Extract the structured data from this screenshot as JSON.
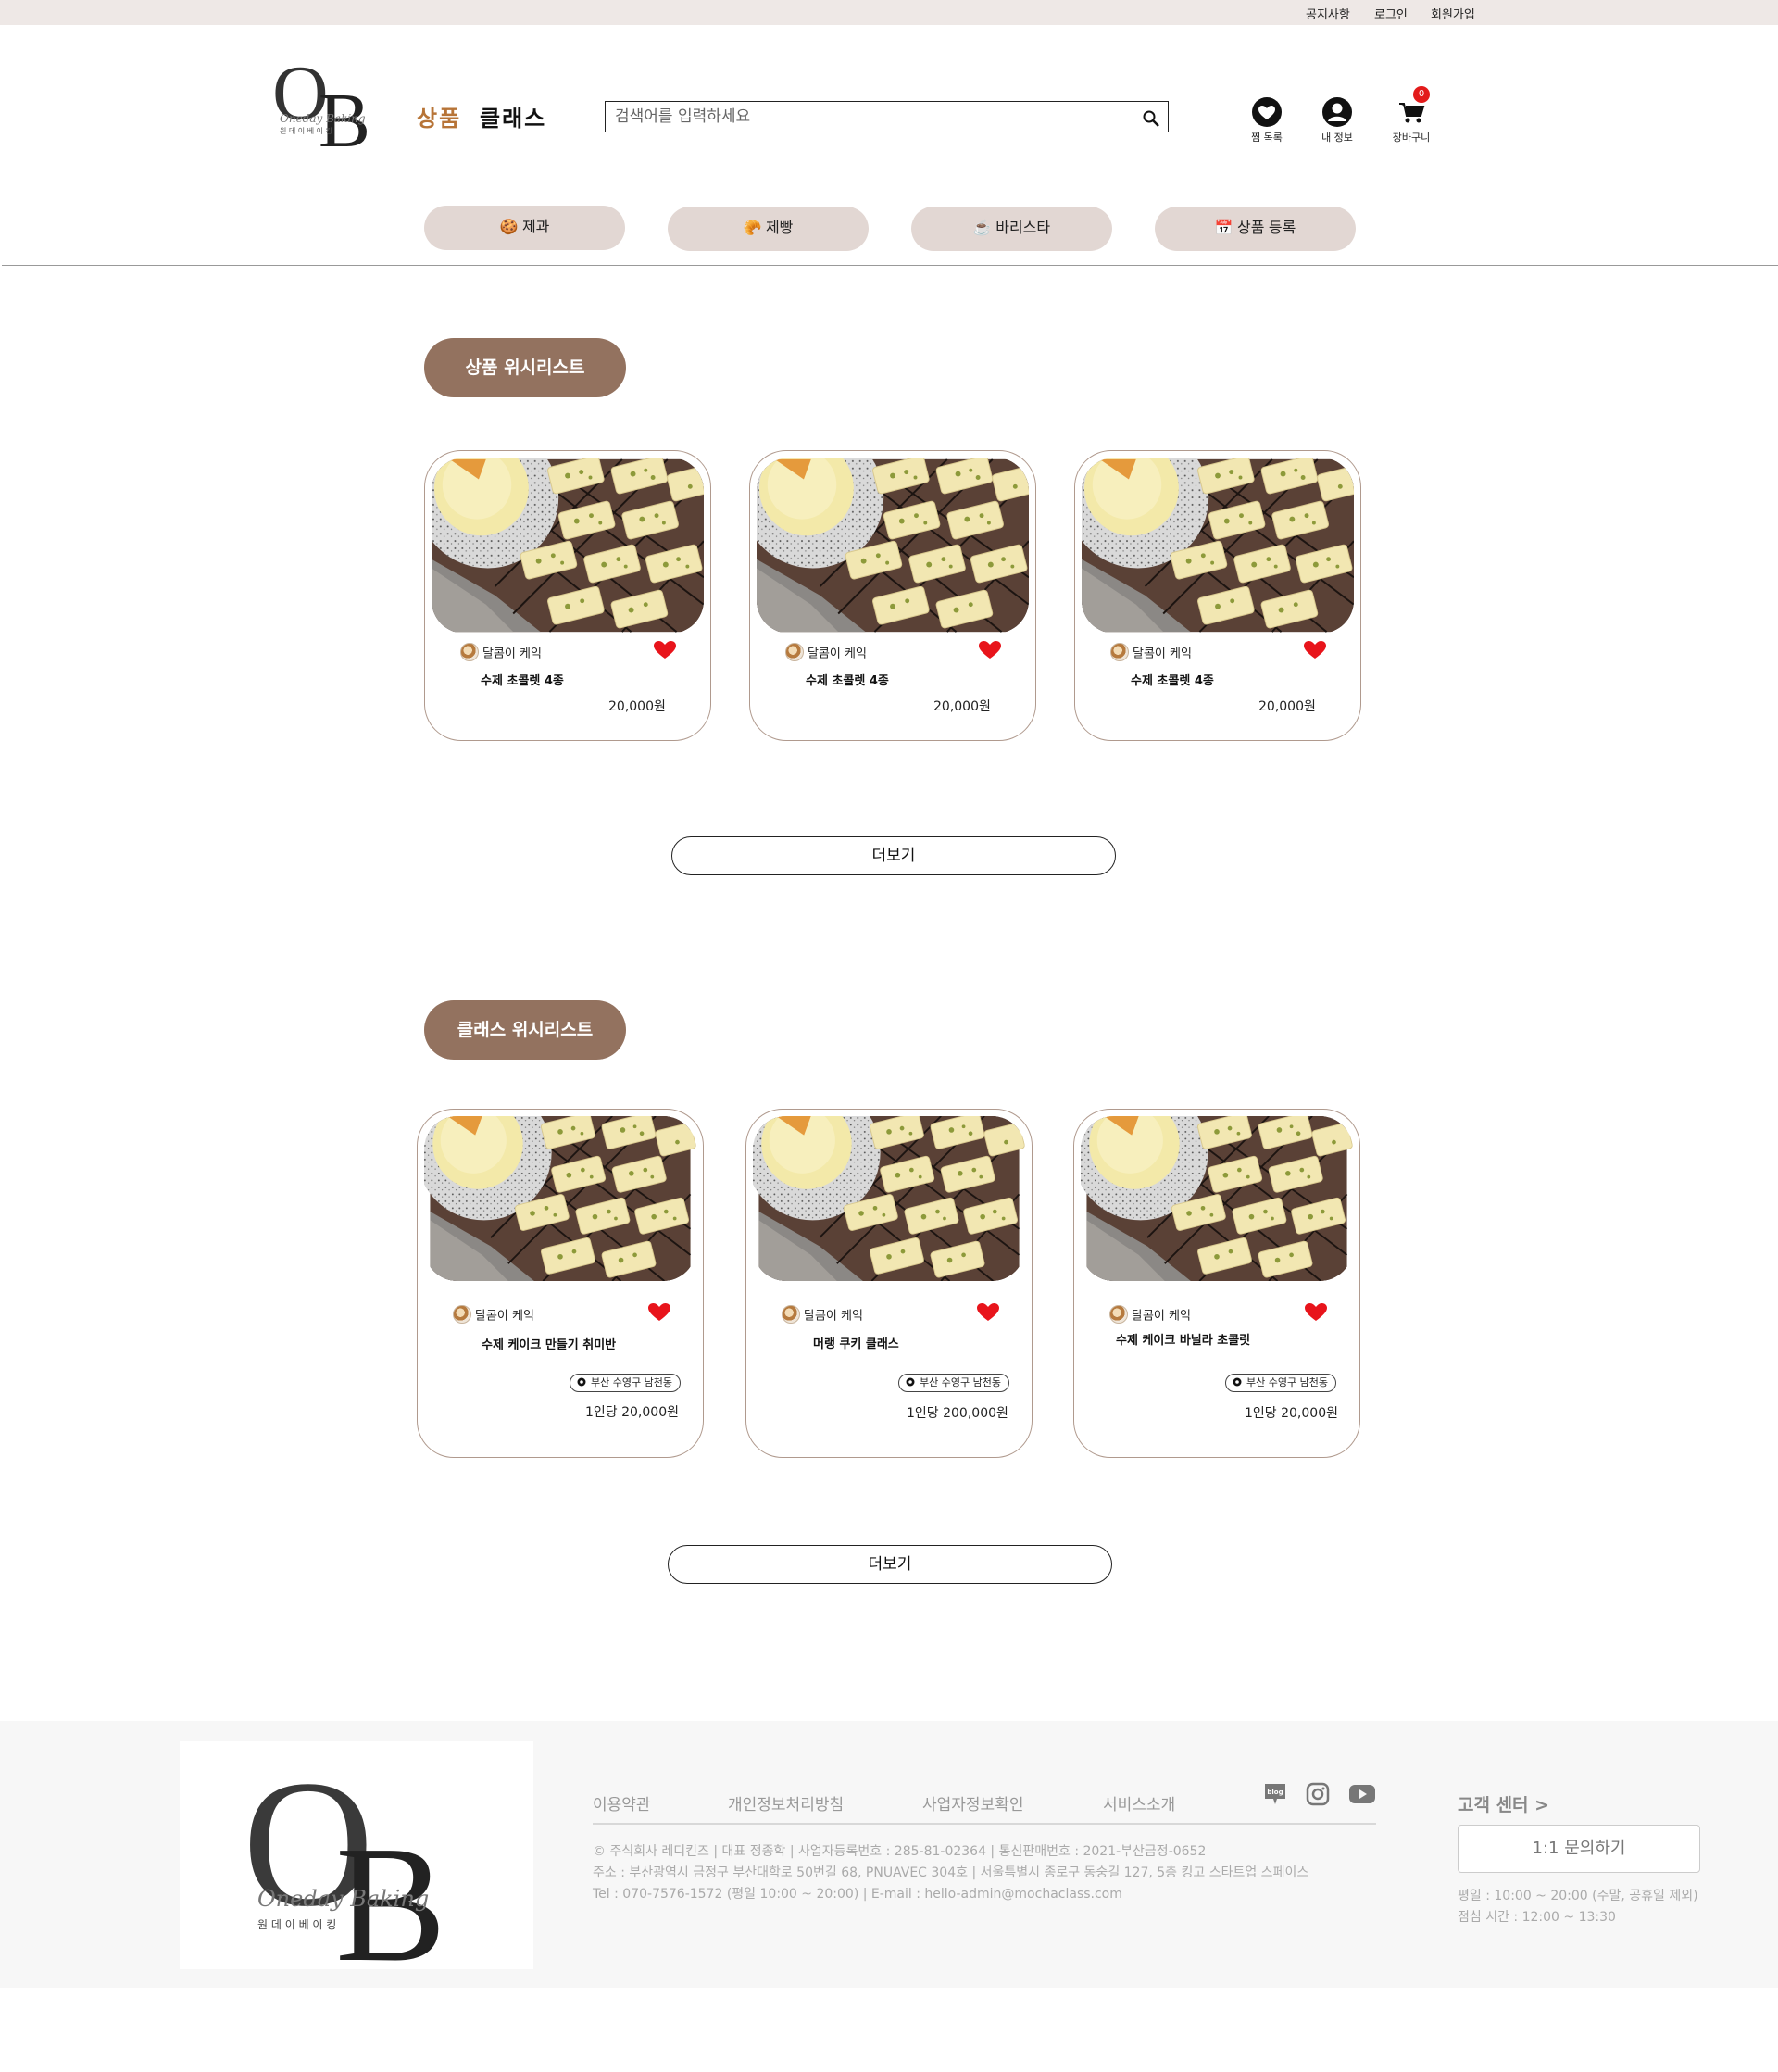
{
  "topbar": {
    "notice": "공지사항",
    "login": "로그인",
    "signup": "회원가입"
  },
  "header": {
    "nav_product": "상품",
    "nav_class": "클래스",
    "search_placeholder": "검색어를 입력하세요",
    "wishlist_label": "찜 목록",
    "myinfo_label": "내 정보",
    "cart_label": "장바구니",
    "cart_count": "0",
    "accent_color": "#b77437"
  },
  "categories": [
    "🍪 제과",
    "🥐 제빵",
    "☕ 바리스타",
    "📅 상품 등록"
  ],
  "product_wishlist": {
    "title": "상품 위시리스트",
    "items": [
      {
        "seller": "달콤이 케익",
        "name": "수제 초콜렛 4종",
        "price": "20,000원"
      },
      {
        "seller": "달콤이 케익",
        "name": "수제 초콜렛 4종",
        "price": "20,000원"
      },
      {
        "seller": "달콤이 케익",
        "name": "수제 초콜렛 4종",
        "price": "20,000원"
      }
    ],
    "more": "더보기"
  },
  "class_wishlist": {
    "title": "클래스 위시리스트",
    "items": [
      {
        "seller": "달콤이 케익",
        "name": "수제 케이크 만들기 취미반",
        "location": "부산 수영구 남천동",
        "price": "1인당 20,000원"
      },
      {
        "seller": "달콤이 케익",
        "name": "머랭 쿠키 클래스",
        "location": "부산 수영구 남천동",
        "price": "1인당  200,000원"
      },
      {
        "seller": "달콤이 케익",
        "name": "수제 케이크 바닐라 초콜릿",
        "location": "부산 수영구 남천동",
        "price": "1인당 20,000원"
      }
    ],
    "more": "더보기"
  },
  "footer": {
    "links": [
      "이용약관",
      "개인정보처리방침",
      "사업자정보확인",
      "서비스소개"
    ],
    "info_line1": "© 주식회사 레디킨즈 | 대표 정종학 | 사업자등록번호 : 285-81-02364 | 통신판매번호 : 2021-부산금정-0652",
    "info_line2": "주소 : 부산광역시 금정구 부산대학로 50번길 68, PNUAVEC 304호 | 서울특별시 종로구 동숭길 127, 5층 킹고 스타트업 스페이스",
    "info_line3": "Tel : 070-7576-1572 (평일 10:00 ~ 20:00) | E-mail : hello-admin@mochaclass.com",
    "cs_title": "고객 센터 >",
    "cs_button": "1:1 문의하기",
    "cs_hours": "평일 : 10:00 ~ 20:00 (주말, 공휴일 제외)",
    "cs_lunch": "점심 시간 : 12:00 ~ 13:30",
    "blog_label": "blog"
  },
  "logo": {
    "letters": "OB",
    "script": "Oneday Baking",
    "korean": "원 데 이   베 이 킹"
  }
}
